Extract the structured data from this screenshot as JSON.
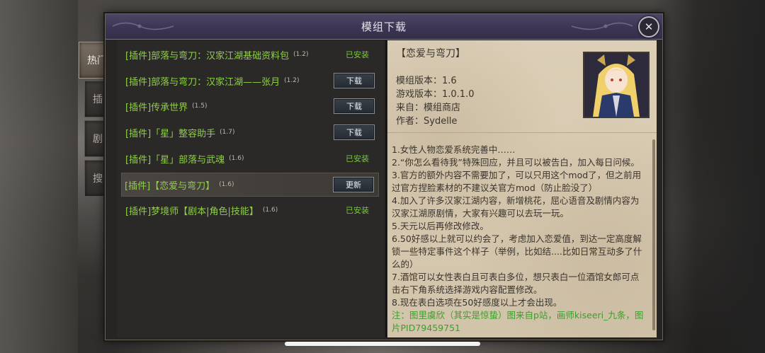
{
  "window": {
    "title": "模组下载"
  },
  "tabs": [
    {
      "label": "热门",
      "active": true
    },
    {
      "label": "插件",
      "active": false
    },
    {
      "label": "剧本",
      "active": false
    },
    {
      "label": "搜索",
      "active": false
    }
  ],
  "mods": [
    {
      "name": "[插件]部落与弯刀：汉家江湖基础资料包",
      "version": "(1.2)",
      "status": "已安装",
      "action": ""
    },
    {
      "name": "[插件]部落与弯刀：汉家江湖——张月",
      "version": "(1.2)",
      "status": "",
      "action": "下载"
    },
    {
      "name": "[插件]传承世界",
      "version": "(1.5)",
      "status": "",
      "action": "下载"
    },
    {
      "name": "[插件]「星」整容助手",
      "version": "(1.7)",
      "status": "",
      "action": "下载"
    },
    {
      "name": "[插件]「星」部落与武魂",
      "version": "(1.6)",
      "status": "已安装",
      "action": ""
    },
    {
      "name": "[插件]【恋爱与弯刀】",
      "version": "(1.6)",
      "status": "",
      "action": "更新",
      "selected": true
    },
    {
      "name": "[插件]梦境师【剧本|角色|技能】",
      "version": "(1.6)",
      "status": "已安装",
      "action": ""
    }
  ],
  "detail": {
    "title": "【恋爱与弯刀】",
    "mod_version": "模组版本：1.6",
    "game_version": "游戏版本：1.0.1.0",
    "source": "来自：模组商店",
    "author": "作者：Sydelle",
    "lines": [
      "1.女性人物恋爱系统完善中……",
      "2.“你怎么看待我”特殊回应，并且可以被告白，加入每日问候。",
      "3.官方的额外内容不需要加了，可以只用这个mod了，但之前用过官方捏脸素材的不建议关官方mod（防止脸没了）",
      "4.加入了许多汉家江湖内容，新增桃花，屈心语音及剧情内容为汉家江湖原剧情，大家有兴趣可以去玩一玩。",
      "5.天元以后再修改修改。",
      "6.50好感以上就可以约会了，考虑加入恋爱值，到达一定高度解锁一些特定事件这个样子（举例，比如结....比如日常互动多了什么的）",
      "7.酒馆可以女性表白且可表白多位，想只表白一位酒馆女郎可点击右下角系统选择游戏内容配置修改。",
      "8.现在表白选项在50好感度以上才会出现。"
    ],
    "note": "注：图里虞欣（其实是惊蛰）图来自p站，画师kiseeri_九条，图片PID79459751"
  }
}
